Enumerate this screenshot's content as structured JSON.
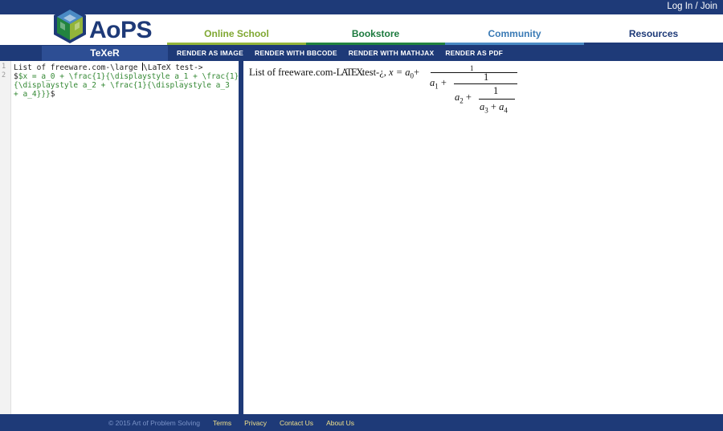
{
  "topbar": {
    "login_label": "Log In / Join"
  },
  "logo": {
    "text": "AoPS"
  },
  "nav": [
    {
      "label": "Online School"
    },
    {
      "label": "Bookstore"
    },
    {
      "label": "Community"
    },
    {
      "label": "Resources"
    }
  ],
  "toolbar": {
    "app_name": "TeXeR",
    "buttons": [
      "RENDER AS IMAGE",
      "RENDER WITH BBCODE",
      "RENDER WITH MATHJAX",
      "RENDER AS PDF"
    ]
  },
  "editor": {
    "line_numbers": [
      "1",
      "2"
    ],
    "line1_a": "List of freeware.com-\\large ",
    "line1_b": "\\LaTeX test->",
    "line2_a": "$x = a_0 + \\frac{1}{\\displaystyle a_1 + \\frac{1}",
    "line2_b": "{\\displaystyle a_2 + \\frac{1}{\\displaystyle a_3",
    "line2_c": "+ a_4}}}",
    "line2_d": "$"
  },
  "preview": {
    "prefix": "List of freeware.com-",
    "latex_logo": "LATEX",
    "suffix": "test-¿",
    "equation_lhs": "x = a",
    "sub0": "0",
    "plus": "+",
    "one": "1",
    "a1": "a",
    "sub1": "1",
    "a2": "a",
    "sub2": "2",
    "a3": "a",
    "sub3": "3",
    "a4": "a",
    "sub4": "4"
  },
  "footer": {
    "copyright": "© 2015 Art of Problem Solving",
    "links": [
      "Terms",
      "Privacy",
      "Contact Us",
      "About Us"
    ]
  },
  "colors": {
    "brand_blue": "#1e3a78",
    "online_school": "#93b53a",
    "bookstore": "#22843f",
    "community": "#4a8ac4",
    "footer_link": "#f0e08a"
  }
}
